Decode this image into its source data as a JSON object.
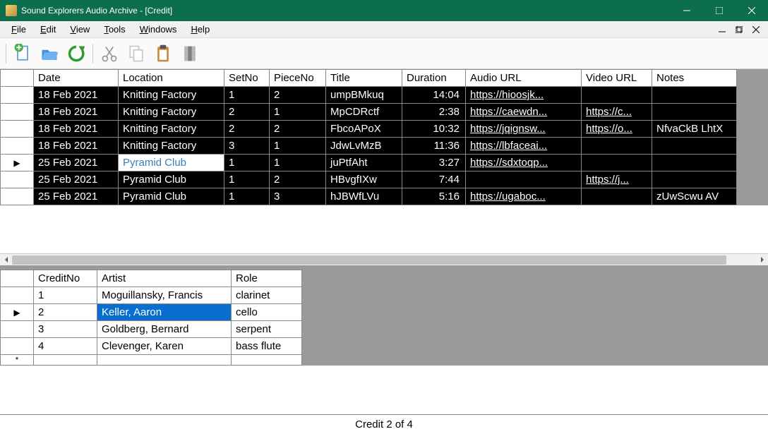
{
  "window": {
    "title": "Sound Explorers Audio Archive - [Credit]"
  },
  "menubar": {
    "file": "File",
    "edit": "Edit",
    "view": "View",
    "tools": "Tools",
    "windows": "Windows",
    "help": "Help"
  },
  "topGrid": {
    "headers": {
      "date": "Date",
      "location": "Location",
      "setno": "SetNo",
      "pieceno": "PieceNo",
      "title": "Title",
      "duration": "Duration",
      "audiourl": "Audio URL",
      "videourl": "Video URL",
      "notes": "Notes"
    },
    "rows": [
      {
        "date": "18 Feb 2021",
        "location": "Knitting Factory",
        "setno": "1",
        "pieceno": "2",
        "title": "umpBMkuq",
        "duration": "14:04",
        "audio": "https://hioosjk...",
        "video": "",
        "notes": ""
      },
      {
        "date": "18 Feb 2021",
        "location": "Knitting Factory",
        "setno": "2",
        "pieceno": "1",
        "title": "MpCDRctf",
        "duration": "2:38",
        "audio": "https://caewdn...",
        "video": "https://c...",
        "notes": ""
      },
      {
        "date": "18 Feb 2021",
        "location": "Knitting Factory",
        "setno": "2",
        "pieceno": "2",
        "title": "FbcoAPoX",
        "duration": "10:32",
        "audio": "https://jqignsw...",
        "video": "https://o...",
        "notes": "NfvaCkB LhtX"
      },
      {
        "date": "18 Feb 2021",
        "location": "Knitting Factory",
        "setno": "3",
        "pieceno": "1",
        "title": "JdwLvMzB",
        "duration": "11:36",
        "audio": "https://lbfaceai...",
        "video": "",
        "notes": ""
      },
      {
        "date": "25 Feb 2021",
        "location": "Pyramid Club",
        "setno": "1",
        "pieceno": "1",
        "title": "juPtfAht",
        "duration": "3:27",
        "audio": "https://sdxtoqp...",
        "video": "",
        "notes": "",
        "selected": "location",
        "rowIndicator": "▶"
      },
      {
        "date": "25 Feb 2021",
        "location": "Pyramid Club",
        "setno": "1",
        "pieceno": "2",
        "title": "HBvgfIXw",
        "duration": "7:44",
        "audio": "",
        "video": "https://j...",
        "notes": ""
      },
      {
        "date": "25 Feb 2021",
        "location": "Pyramid Club",
        "setno": "1",
        "pieceno": "3",
        "title": "hJBWfLVu",
        "duration": "5:16",
        "audio": "https://ugaboc...",
        "video": "",
        "notes": "zUwScwu AV"
      }
    ]
  },
  "bottomGrid": {
    "headers": {
      "creditno": "CreditNo",
      "artist": "Artist",
      "role": "Role"
    },
    "rows": [
      {
        "creditno": "1",
        "artist": "Moguillansky, Francis",
        "role": "clarinet"
      },
      {
        "creditno": "2",
        "artist": "Keller, Aaron",
        "role": "cello",
        "selected": "artist",
        "rowIndicator": "▶"
      },
      {
        "creditno": "3",
        "artist": "Goldberg, Bernard",
        "role": "serpent"
      },
      {
        "creditno": "4",
        "artist": "Clevenger, Karen",
        "role": "bass flute"
      }
    ],
    "newRowIndicator": "*"
  },
  "status": {
    "text": "Credit 2 of 4"
  }
}
